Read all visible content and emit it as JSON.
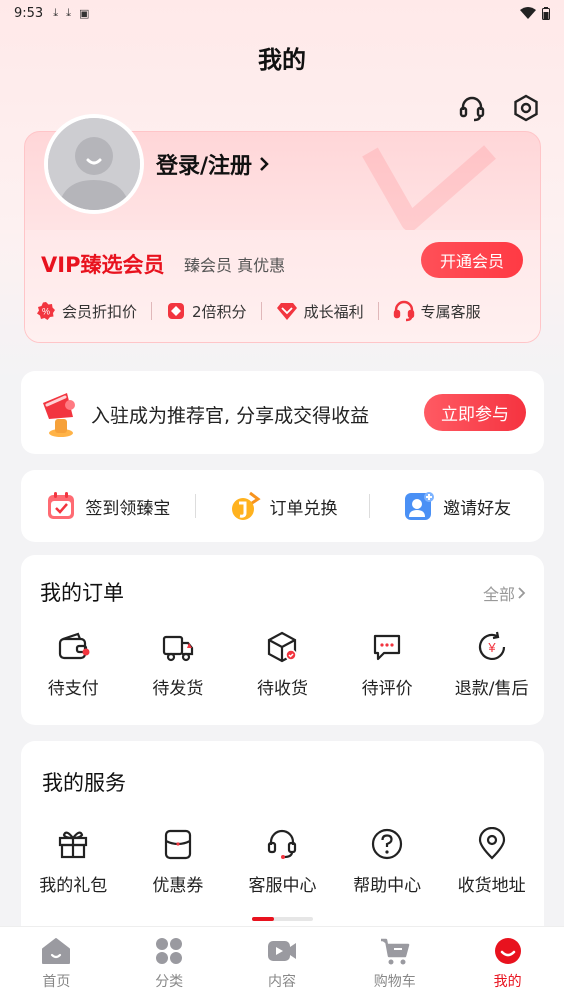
{
  "status_bar": {
    "time": "9:53"
  },
  "page": {
    "title": "我的"
  },
  "profile": {
    "login_label": "登录/注册"
  },
  "membership": {
    "title": "VIP臻选会员",
    "subtitle": "臻会员 真优惠",
    "open_button": "开通会员",
    "perks": [
      {
        "label": "会员折扣价",
        "icon": "discount-badge-icon"
      },
      {
        "label": "2倍积分",
        "icon": "points-icon"
      },
      {
        "label": "成长福利",
        "icon": "diamond-icon"
      },
      {
        "label": "专属客服",
        "icon": "headset-icon"
      }
    ]
  },
  "promo": {
    "text": "入驻成为推荐官, 分享成交得收益",
    "button": "立即参与"
  },
  "quick_actions": [
    {
      "label": "签到领臻宝",
      "icon": "calendar-check-icon"
    },
    {
      "label": "订单兑换",
      "icon": "exchange-icon"
    },
    {
      "label": "邀请好友",
      "icon": "add-friend-icon"
    }
  ],
  "orders": {
    "title": "我的订单",
    "all_link": "全部",
    "items": [
      {
        "label": "待支付",
        "icon": "wallet-icon"
      },
      {
        "label": "待发货",
        "icon": "truck-icon"
      },
      {
        "label": "待收货",
        "icon": "package-icon"
      },
      {
        "label": "待评价",
        "icon": "comment-icon"
      },
      {
        "label": "退款/售后",
        "icon": "refund-icon"
      }
    ]
  },
  "services": {
    "title": "我的服务",
    "items": [
      {
        "label": "我的礼包",
        "icon": "gift-icon"
      },
      {
        "label": "优惠券",
        "icon": "coupon-icon"
      },
      {
        "label": "客服中心",
        "icon": "headset-icon"
      },
      {
        "label": "帮助中心",
        "icon": "help-icon"
      },
      {
        "label": "收货地址",
        "icon": "location-icon"
      }
    ]
  },
  "tabs": [
    {
      "label": "首页",
      "icon": "home-icon",
      "active": false
    },
    {
      "label": "分类",
      "icon": "category-icon",
      "active": false
    },
    {
      "label": "内容",
      "icon": "video-icon",
      "active": false
    },
    {
      "label": "购物车",
      "icon": "cart-icon",
      "active": false
    },
    {
      "label": "我的",
      "icon": "profile-icon",
      "active": true
    }
  ],
  "colors": {
    "accent": "#e8121e",
    "button_gradient": "#ff4650",
    "background": "#f3f3f5"
  }
}
